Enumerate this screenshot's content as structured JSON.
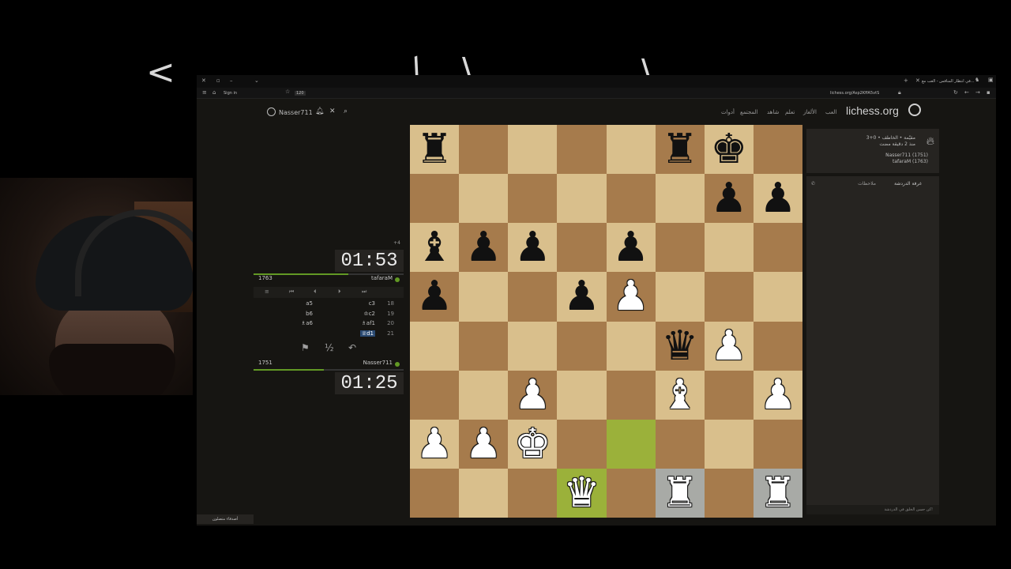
{
  "browser": {
    "tab_title": "في انتظار المنافس - العب مع...",
    "url": "lichess.org/Asp2KffA5vtS",
    "sign_in": "Sign in",
    "badge": "120"
  },
  "site": {
    "logo": "lichess.org",
    "username": "Nasser711",
    "nav": [
      "العب",
      "الألغاز",
      "تعلم",
      "شاهد",
      "المجتمع",
      "أدوات"
    ]
  },
  "game": {
    "variant": "3+0 • مقيّمة • الخاطف",
    "ago": "منذ 2 دقيقة مضت",
    "white": "Nasser711 (1751)",
    "black": "tafaraM (1763)",
    "chat_tab": "غرفة الدردشة",
    "notes_tab": "ملاحظات",
    "chat_placeholder": "كن حسن الخلق في الدردشة!"
  },
  "opponent": {
    "name": "tafaraM",
    "rating": "1763",
    "clock": "01:53",
    "material": "+4",
    "time_fraction": 0.63
  },
  "me": {
    "name": "Nasser711",
    "rating": "1751",
    "clock": "01:25",
    "time_fraction": 0.47
  },
  "moves": [
    {
      "n": "18",
      "w": "c3",
      "b": "a5"
    },
    {
      "n": "19",
      "w": "♔c2",
      "b": "b6"
    },
    {
      "n": "20",
      "w": "♗af1",
      "b": "♗a6"
    },
    {
      "n": "21",
      "w": "♕d1",
      "b": ""
    }
  ],
  "board": [
    [
      "r",
      "",
      "",
      "",
      "",
      "r",
      "k",
      ""
    ],
    [
      "",
      "",
      "",
      "",
      "",
      "",
      "p",
      "p"
    ],
    [
      "b",
      "p",
      "p",
      "",
      "p",
      "",
      "",
      ""
    ],
    [
      "p",
      "",
      "",
      "p",
      "P",
      "",
      "",
      ""
    ],
    [
      "",
      "",
      "",
      "",
      "",
      "q",
      "P",
      ""
    ],
    [
      "",
      "",
      "P",
      "",
      "",
      "B",
      "",
      "P"
    ],
    [
      "P",
      "P",
      "K",
      "",
      "",
      "",
      "",
      ""
    ],
    [
      "",
      "",
      "",
      "Q",
      "",
      "R",
      "",
      "R"
    ]
  ],
  "highlights": {
    "last_move": [
      "6-4",
      "7-3"
    ],
    "selected": [
      "7-5",
      "7-7"
    ]
  },
  "friends": "أصدقاء متصلون"
}
